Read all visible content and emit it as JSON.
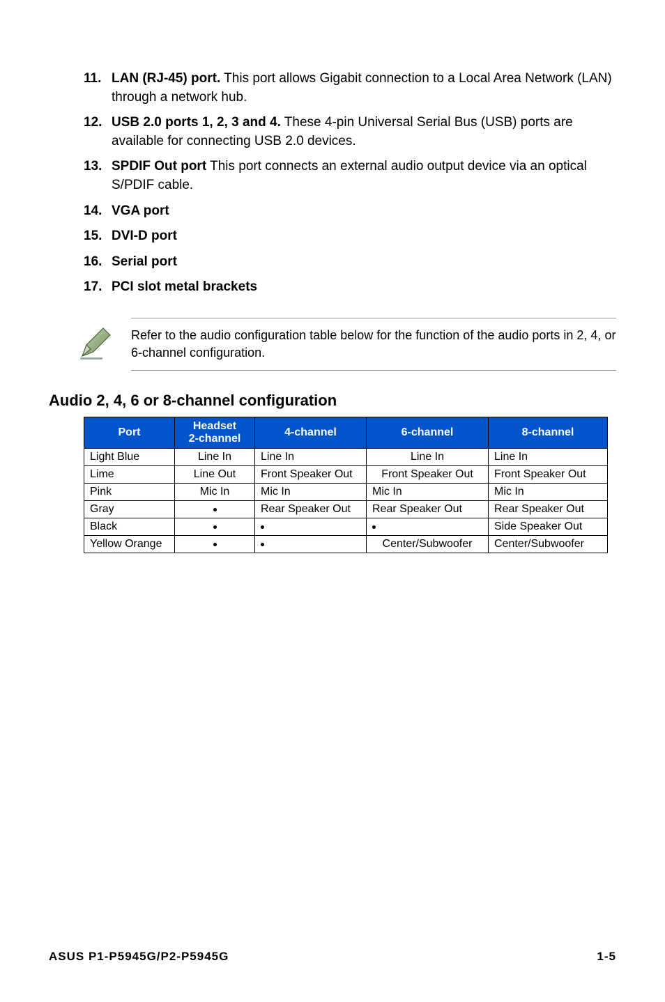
{
  "list": [
    {
      "num": "11.",
      "title": "LAN (RJ-45) port.",
      "desc": " This port allows Gigabit connection to a Local Area Network (LAN) through a network hub."
    },
    {
      "num": "12.",
      "title": "USB 2.0 ports 1, 2, 3 and 4.",
      "desc": " These 4-pin Universal Serial Bus (USB) ports are available for connecting USB 2.0 devices."
    },
    {
      "num": "13.",
      "title": "SPDIF Out port",
      "desc": " This port connects an external audio output device via an optical S/PDIF cable."
    },
    {
      "num": "14.",
      "title": "VGA port",
      "desc": ""
    },
    {
      "num": "15.",
      "title": "DVI-D port",
      "desc": ""
    },
    {
      "num": "16.",
      "title": "Serial port",
      "desc": ""
    },
    {
      "num": "17.",
      "title": "PCI slot metal brackets",
      "desc": ""
    }
  ],
  "note": "Refer to the audio configuration table below for the function of the audio ports in 2, 4, or 6-channel configuration.",
  "section_title": "Audio 2, 4, 6 or 8-channel configuration",
  "table": {
    "headers": {
      "port": "Port",
      "h2a": "Headset",
      "h2b": "2-channel",
      "h4": "4-channel",
      "h6": "6-channel",
      "h8": "8-channel"
    },
    "rows": [
      {
        "port": "Light Blue",
        "c2": "Line In",
        "c4": "Line In",
        "c6": "Line In",
        "c8": "Line In"
      },
      {
        "port": "Lime",
        "c2": "Line Out",
        "c4": "Front Speaker Out",
        "c6": "Front Speaker Out",
        "c8": "Front Speaker Out"
      },
      {
        "port": "Pink",
        "c2": "Mic In",
        "c4": "Mic In",
        "c6": "Mic In",
        "c8": "Mic In"
      },
      {
        "port": "Gray",
        "c2": "•",
        "c4": "Rear Speaker Out",
        "c6": "Rear Speaker Out",
        "c8": "Rear Speaker Out"
      },
      {
        "port": "Black",
        "c2": "•",
        "c4": "•",
        "c6": "•",
        "c8": "Side Speaker Out"
      },
      {
        "port": "Yellow Orange",
        "c2": "•",
        "c4": "•",
        "c6": "Center/Subwoofer",
        "c8": "Center/Subwoofer"
      }
    ]
  },
  "footer": {
    "left": "ASUS P1-P5945G/P2-P5945G",
    "right": "1-5"
  }
}
